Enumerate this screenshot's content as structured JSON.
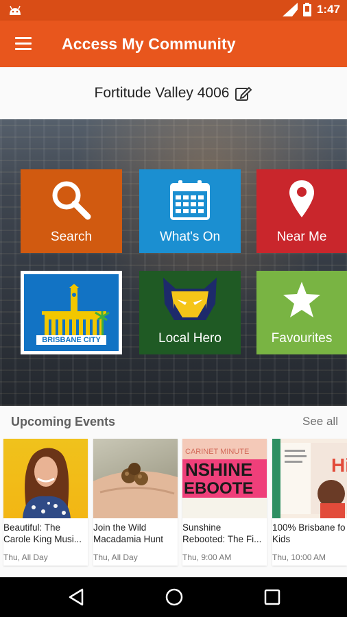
{
  "status": {
    "time": "1:47"
  },
  "app": {
    "title": "Access My Community"
  },
  "location": {
    "label": "Fortitude Valley 4006"
  },
  "tiles": {
    "search": "Search",
    "whats_on": "What's On",
    "near_me": "Near Me",
    "brisbane": "BRISBANE CITY",
    "local_hero": "Local Hero",
    "favourites": "Favourites"
  },
  "events": {
    "title": "Upcoming Events",
    "see_all": "See all",
    "items": [
      {
        "line1": "Beautiful: The",
        "line2": "Carole King Musi...",
        "date": "Thu, All Day"
      },
      {
        "line1": "Join the Wild",
        "line2": "Macadamia Hunt",
        "date": "Thu, All Day"
      },
      {
        "line1": "Sunshine",
        "line2": "Rebooted: The Fi...",
        "date": "Thu, 9:00 AM"
      },
      {
        "line1": "100% Brisbane fo",
        "line2": "Kids",
        "date": "Thu, 10:00 AM"
      }
    ]
  },
  "colors": {
    "primary": "#e8561d",
    "statusbar": "#d94d16",
    "search": "#d15a10",
    "whats_on": "#1b8fd1",
    "near_me": "#c9262c",
    "local_hero": "#1f5a24",
    "favourites": "#79b443"
  }
}
